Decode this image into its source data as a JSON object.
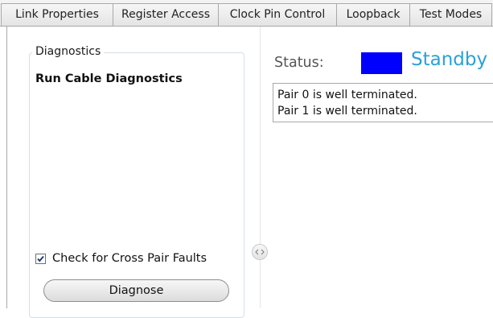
{
  "tabs": [
    {
      "label": "Link Properties",
      "active": false
    },
    {
      "label": "Register Access",
      "active": false
    },
    {
      "label": "Clock Pin Control",
      "active": false
    },
    {
      "label": "Loopback",
      "active": false
    },
    {
      "label": "Test Modes",
      "active": false
    }
  ],
  "diagnostics": {
    "group_label": "Diagnostics",
    "run_title": "Run Cable Diagnostics",
    "cross_pair": {
      "label": "Check for Cross Pair Faults",
      "checked": true
    },
    "button_label": "Diagnose"
  },
  "status": {
    "label": "Status:",
    "value": "Standby",
    "indicator_color": "#0000ff",
    "value_color": "#2aa1d8"
  },
  "results": [
    "Pair 0 is well terminated.",
    "Pair 1 is well terminated."
  ],
  "icons": {
    "splitter": "collapse-expand-icon",
    "check": "checkmark-icon"
  }
}
